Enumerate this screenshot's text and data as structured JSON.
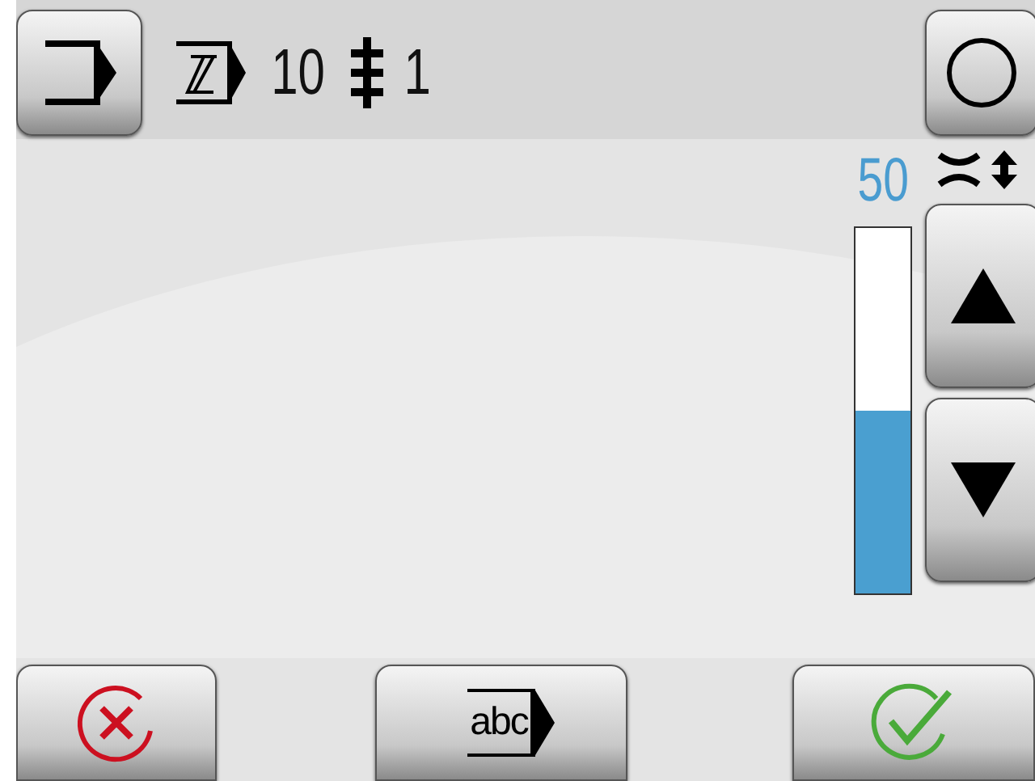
{
  "header": {
    "count": "10",
    "step": "1"
  },
  "meter": {
    "reading": "50",
    "level": 0.5
  },
  "footer": {
    "label": "abc"
  }
}
